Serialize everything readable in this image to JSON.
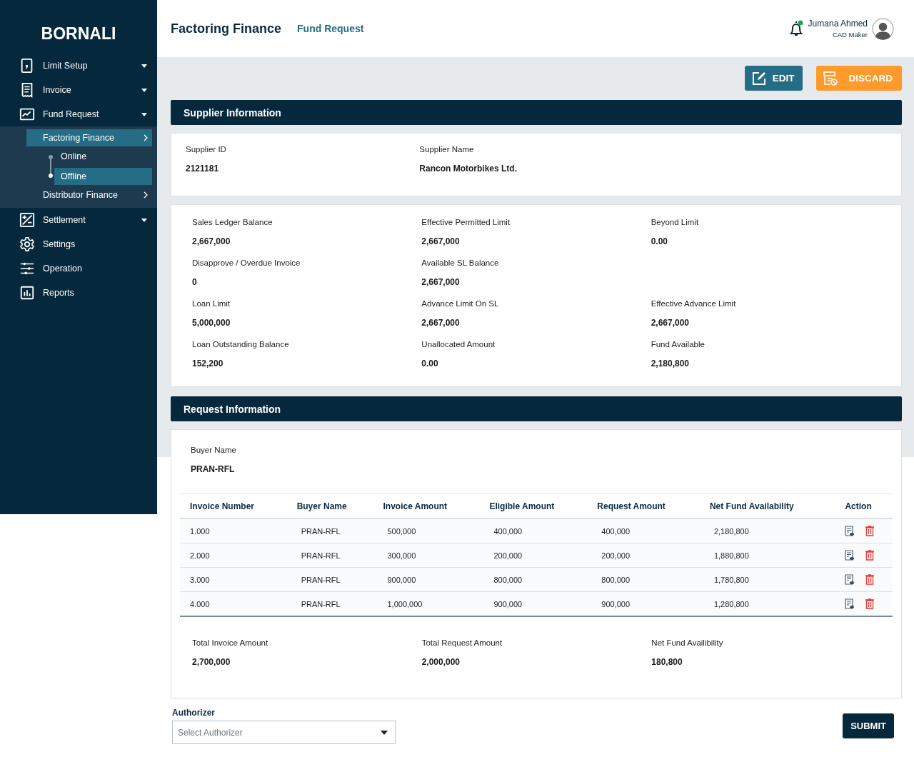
{
  "brand": "BORNALI",
  "nav": [
    {
      "label": "Limit Setup",
      "kind": "menu"
    },
    {
      "label": "Invoice",
      "kind": "menu"
    },
    {
      "label": "Fund Request",
      "kind": "menu",
      "expanded": true,
      "children": [
        {
          "label": "Factoring Finance",
          "selected": true,
          "children": [
            {
              "label": "Online",
              "selected": false
            },
            {
              "label": "Offline",
              "selected": true
            }
          ]
        },
        {
          "label": "Distributor Finance",
          "selected": false
        }
      ]
    },
    {
      "label": "Settlement",
      "kind": "menu"
    },
    {
      "label": "Settings",
      "kind": "link"
    },
    {
      "label": "Operation",
      "kind": "link"
    },
    {
      "label": "Reports",
      "kind": "link"
    }
  ],
  "header": {
    "title": "Factoring Finance",
    "subtitle": "Fund Request",
    "notification": true,
    "user_name": "Jumana Ahmed",
    "user_role": "CAD Maker"
  },
  "actions": [
    {
      "label": "EDIT",
      "kind": "edit"
    },
    {
      "label": "DISCARD",
      "kind": "discard"
    }
  ],
  "supplier": {
    "title": "Supplier Information",
    "fields": [
      {
        "label": "Supplier ID",
        "value": "2121181"
      },
      {
        "label": "Supplier Name",
        "value": "Rancon Motorbikes Ltd."
      }
    ]
  },
  "balances": [
    [
      {
        "label": "Sales Ledger Balance",
        "value": "2,667,000"
      },
      {
        "label": "Effective Permitted Limit",
        "value": "2,667,000"
      },
      {
        "label": "Beyond Limit",
        "value": "0.00"
      }
    ],
    [
      {
        "label": "Disapprove / Overdue Invoice",
        "value": "0"
      },
      {
        "label": "Available SL Balance",
        "value": "2,667,000"
      }
    ],
    [
      {
        "label": "Loan Limit",
        "value": "5,000,000"
      },
      {
        "label": "Advance Limit On SL",
        "value": "2,667,000"
      },
      {
        "label": "Effective Advance Limit",
        "value": "2,667,000"
      }
    ],
    [
      {
        "label": "Loan Outstanding Balance",
        "value": "152,200"
      },
      {
        "label": "Unallocated Amount",
        "value": "0.00"
      },
      {
        "label": "Fund Available",
        "value": "2,180,800"
      }
    ]
  ],
  "request": {
    "title": "Request Information",
    "buyer": {
      "label": "Buyer Name",
      "value": "PRAN-RFL"
    },
    "table": {
      "columns": [
        "Invoice Number",
        "Buyer Name",
        "Invoice Amount",
        "Eligible Amount",
        "Request Amount",
        "Net Fund Availability",
        "Action"
      ],
      "rows": [
        [
          "1.000",
          "PRAN-RFL",
          "500,000",
          "400,000",
          "400,000",
          "2,180,800"
        ],
        [
          "2.000",
          "PRAN-RFL",
          "300,000",
          "200,000",
          "200,000",
          "1,880,800"
        ],
        [
          "3.000",
          "PRAN-RFL",
          "900,000",
          "800,000",
          "800,000",
          "1,780,800"
        ],
        [
          "4.000",
          "PRAN-RFL",
          "1,000,000",
          "900,000",
          "900,000",
          "1,280,800"
        ]
      ]
    },
    "totals": [
      {
        "label": "Total Invoice Amount",
        "value": "2,700,000"
      },
      {
        "label": "Total Request Amount",
        "value": "2,000,000"
      },
      {
        "label": "Net Fund Availibility",
        "value": "180,800"
      }
    ]
  },
  "authorizer": {
    "label": "Authorizer",
    "placeholder": "Select Authorizer"
  },
  "submit": "SUBMIT"
}
